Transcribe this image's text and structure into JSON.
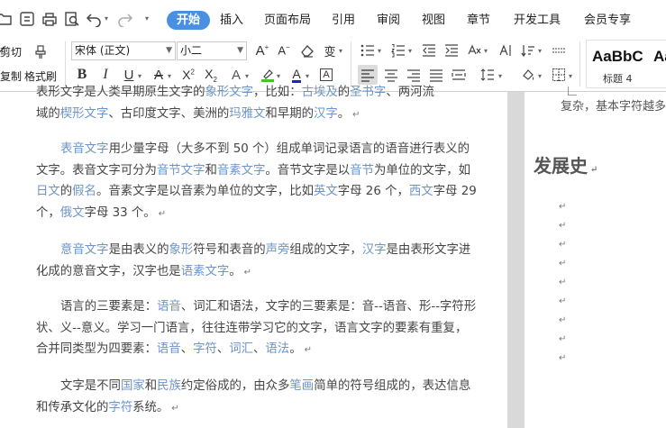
{
  "menubar": {
    "tabs": [
      {
        "label": "开始",
        "active": true
      },
      {
        "label": "插入"
      },
      {
        "label": "页面布局"
      },
      {
        "label": "引用"
      },
      {
        "label": "审阅"
      },
      {
        "label": "视图"
      },
      {
        "label": "章节"
      },
      {
        "label": "开发工具"
      },
      {
        "label": "会员专享"
      }
    ],
    "quick_access_icons": [
      "folder-icon",
      "save-icon",
      "print-icon",
      "print-preview-icon",
      "undo-icon",
      "redo-icon"
    ]
  },
  "ribbon": {
    "clipboard": {
      "cut_label": "剪切",
      "copy_label": "复制",
      "format_painter_label": "格式刷"
    },
    "font": {
      "family": "宋体 (正文)",
      "size": "小二"
    },
    "styles": {
      "preview_text": "AaBbC",
      "preview_text_2": "Aa",
      "style_name": "标题 4"
    },
    "colors": {
      "accent": "#4a90e2",
      "highlight": "#4ac02c",
      "font_color": "#2222cc"
    }
  },
  "document": {
    "left_page": {
      "para0": {
        "line1_parts": [
          "表形文字是人类早期原生文字的",
          "象形文字",
          "，比如：",
          "古埃及",
          "的",
          "圣书字",
          "、两河流"
        ],
        "line2_parts": [
          "域的",
          "楔形文字",
          "、古印度文字、美洲的",
          "玛雅文",
          "和早期的",
          "汉字",
          "。"
        ]
      },
      "para1": {
        "parts": [
          "表音文字",
          "用少量字母（大多不到 50 个）组成单词记录语言的语音进行表义的文字。表音文字可分为",
          "音节文字",
          "和",
          "音素文字",
          "。音节文字是以",
          "音节",
          "为单位的文字，如",
          "日文",
          "的",
          "假名",
          "。音素文字是以音素为单位的文字，比如",
          "英文",
          "字母 26 个，",
          "西文",
          "字母 29 个，",
          "俄文",
          "字母 33 个。"
        ]
      },
      "para2": {
        "parts": [
          "意音文字",
          "是由表义的",
          "象形",
          "符号和表音的",
          "声旁",
          "组成的文字，",
          "汉字",
          "是由表形文字进化成的意音文字，汉字也是",
          "语素文字",
          "。"
        ]
      },
      "para3": {
        "parts": [
          "语言的三要素是：",
          "语音",
          "、词汇和语法，文字的三要素是：音--语音、形--字符形状、义--意义。学习一门语言，往往连带学习它的文字，语言文字的要素有重复，合并同类型为四要素：",
          "语音",
          "、",
          "字符",
          "、",
          "词汇",
          "、",
          "语法",
          "。"
        ]
      },
      "para4": {
        "parts": [
          "文字是不同",
          "国家",
          "和",
          "民族",
          "约定俗成的，由众多",
          "笔画",
          "简单的符号组成的，表达信息和传承文化的",
          "字符",
          "系统。"
        ]
      }
    },
    "right_page": {
      "top_text": "复杂，基本字符越多",
      "heading": "发展史",
      "empty_paragraph_count": 9
    }
  }
}
